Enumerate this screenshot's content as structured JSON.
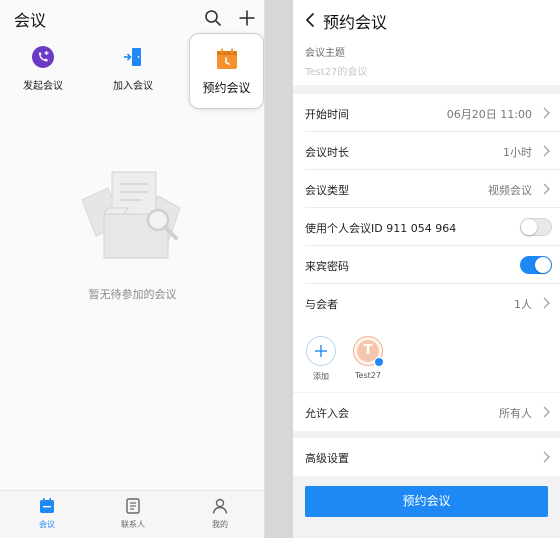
{
  "left": {
    "title": "会议",
    "quick_actions": {
      "start": {
        "label": "发起会议",
        "icon": "phone-plus-icon"
      },
      "join": {
        "label": "加入会议",
        "icon": "join-door-icon"
      },
      "schedule": {
        "label": "预约会议",
        "icon": "calendar-icon"
      }
    },
    "empty_text": "暂无待参加的会议",
    "tabs": [
      {
        "label": "会议",
        "icon": "calendar-tab-icon",
        "active": true
      },
      {
        "label": "联系人",
        "icon": "contacts-icon",
        "active": false
      },
      {
        "label": "我的",
        "icon": "person-icon",
        "active": false
      }
    ]
  },
  "right": {
    "title": "预约会议",
    "topic": {
      "label": "会议主题",
      "placeholder": "Test27的会议"
    },
    "rows": {
      "start_time": {
        "label": "开始时间",
        "value": "06月20日 11:00"
      },
      "duration": {
        "label": "会议时长",
        "value": "1小时"
      },
      "type": {
        "label": "会议类型",
        "value": "视频会议"
      },
      "personal_id": {
        "label": "使用个人会议ID 911 054 964",
        "enabled": false
      },
      "guest_password": {
        "label": "来宾密码",
        "enabled": true
      },
      "participants": {
        "label": "与会者",
        "value": "1人"
      },
      "allow_join": {
        "label": "允许入会",
        "value": "所有人"
      },
      "advanced": {
        "label": "高级设置"
      }
    },
    "participant_list": {
      "add_label": "添加",
      "members": [
        {
          "initial": "T",
          "name": "Test27"
        }
      ]
    },
    "submit_label": "预约会议"
  },
  "colors": {
    "accent": "#1e88f4",
    "schedule_orange": "#f5922f",
    "start_purple": "#6c3bc6"
  }
}
